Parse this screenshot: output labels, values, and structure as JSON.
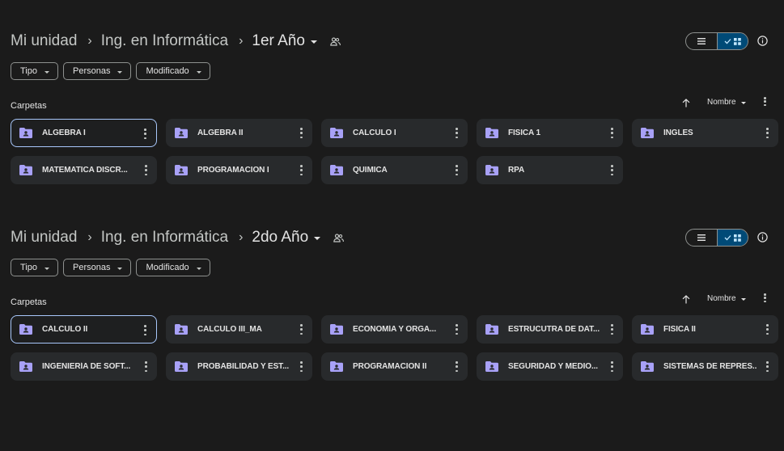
{
  "sections": [
    {
      "breadcrumb": {
        "root": "Mi unidad",
        "parent": "Ing. en Informática",
        "current": "1er Año"
      },
      "filters": [
        "Tipo",
        "Personas",
        "Modificado"
      ],
      "folders_heading": "Carpetas",
      "sort_label": "Nombre",
      "folders": [
        "ALGEBRA I",
        "ALGEBRA II",
        "CALCULO I",
        "FISICA 1",
        "INGLES",
        "MATEMATICA DISCR...",
        "PROGRAMACION I",
        "QUIMICA",
        "RPA"
      ],
      "selected_folder": "ALGEBRA I"
    },
    {
      "breadcrumb": {
        "root": "Mi unidad",
        "parent": "Ing. en Informática",
        "current": "2do Año"
      },
      "filters": [
        "Tipo",
        "Personas",
        "Modificado"
      ],
      "folders_heading": "Carpetas",
      "sort_label": "Nombre",
      "folders": [
        "CÁLCULO II",
        "CÁLCULO III_MA",
        "ECONOMÍA Y ORGA...",
        "ESTRUCUTRA DE DAT...",
        "FISICA II",
        "INGENIERÍA DE SOFT...",
        "PROBABILIDAD Y EST...",
        "PROGRAMACION II",
        "SEGURIDAD Y MEDIO...",
        "SISTEMAS DE REPRES..."
      ],
      "selected_folder": "CÁLCULO II"
    }
  ],
  "icons": {
    "shared": "people-icon",
    "list_view": "list-view-icon",
    "grid_view": "grid-view-icon",
    "info": "info-icon",
    "sort": "arrow-up-icon",
    "folder": "shared-folder-icon",
    "more": "more-vertical-icon"
  },
  "colors": {
    "background": "#1b1b1b",
    "card": "#282a2c",
    "selected_border": "#a8c7fa",
    "folder_accent": "#a8a1f7",
    "toggle_active": "#004a77"
  }
}
